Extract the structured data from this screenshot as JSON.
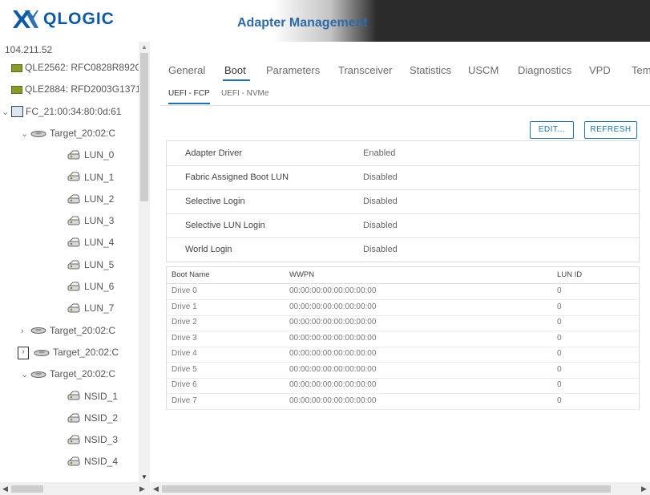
{
  "brand": {
    "logo_text": "QLOGIC",
    "app_title": "Adapter Management"
  },
  "tree": {
    "host": "104.211.52",
    "items": [
      {
        "kind": "adapter",
        "label": "QLE2562: RFC0828R892C"
      },
      {
        "kind": "adapter",
        "label": "QLE2884: RFD2003G1371-"
      },
      {
        "kind": "port",
        "label": "FC_21:00:34:80:0d:61",
        "chevron": "⌄"
      },
      {
        "kind": "target",
        "label": "Target_20:02:C",
        "chevron": "⌄"
      },
      {
        "kind": "lun",
        "label": "LUN_0"
      },
      {
        "kind": "lun",
        "label": "LUN_1"
      },
      {
        "kind": "lun",
        "label": "LUN_2"
      },
      {
        "kind": "lun",
        "label": "LUN_3"
      },
      {
        "kind": "lun",
        "label": "LUN_4"
      },
      {
        "kind": "lun",
        "label": "LUN_5"
      },
      {
        "kind": "lun",
        "label": "LUN_6"
      },
      {
        "kind": "lun",
        "label": "LUN_7"
      },
      {
        "kind": "target",
        "label": "Target_20:02:C",
        "chevron": "›"
      },
      {
        "kind": "target-boxed",
        "label": "Target_20:02:C",
        "chevron": "›"
      },
      {
        "kind": "target",
        "label": "Target_20:02:C",
        "chevron": "⌄"
      },
      {
        "kind": "lun",
        "label": "NSID_1"
      },
      {
        "kind": "lun",
        "label": "NSID_2"
      },
      {
        "kind": "lun",
        "label": "NSID_3"
      },
      {
        "kind": "lun",
        "label": "NSID_4"
      }
    ]
  },
  "tabs": [
    "General",
    "Boot",
    "Parameters",
    "Transceiver",
    "Statistics",
    "USCM",
    "Diagnostics",
    "VPD",
    "Tem"
  ],
  "active_tab": "Boot",
  "subtabs": [
    "UEFI - FCP",
    "UEFI - NVMe"
  ],
  "active_subtab": "UEFI - FCP",
  "buttons": {
    "edit": "EDIT...",
    "refresh": "REFRESH"
  },
  "properties": [
    {
      "name": "Adapter Driver",
      "value": "Enabled"
    },
    {
      "name": "Fabric Assigned Boot LUN",
      "value": "Disabled"
    },
    {
      "name": "Selective Login",
      "value": "Disabled"
    },
    {
      "name": "Selective LUN Login",
      "value": "Disabled"
    },
    {
      "name": "World Login",
      "value": "Disabled"
    }
  ],
  "boot_table": {
    "columns": [
      "Boot Name",
      "WWPN",
      "LUN ID"
    ],
    "rows": [
      [
        "Drive 0",
        "00:00:00:00:00:00:00:00",
        "0"
      ],
      [
        "Drive 1",
        "00:00:00:00:00:00:00:00",
        "0"
      ],
      [
        "Drive 2",
        "00:00:00:00:00:00:00:00",
        "0"
      ],
      [
        "Drive 3",
        "00:00:00:00:00:00:00:00",
        "0"
      ],
      [
        "Drive 4",
        "00:00:00:00:00:00:00:00",
        "0"
      ],
      [
        "Drive 5",
        "00:00:00:00:00:00:00:00",
        "0"
      ],
      [
        "Drive 6",
        "00:00:00:00:00:00:00:00",
        "0"
      ],
      [
        "Drive 7",
        "00:00:00:00:00:00:00:00",
        "0"
      ]
    ]
  },
  "colors": {
    "accent": "#1a73b8",
    "header_bg": "#2b2b2b",
    "brand": "#0a5aa6"
  }
}
